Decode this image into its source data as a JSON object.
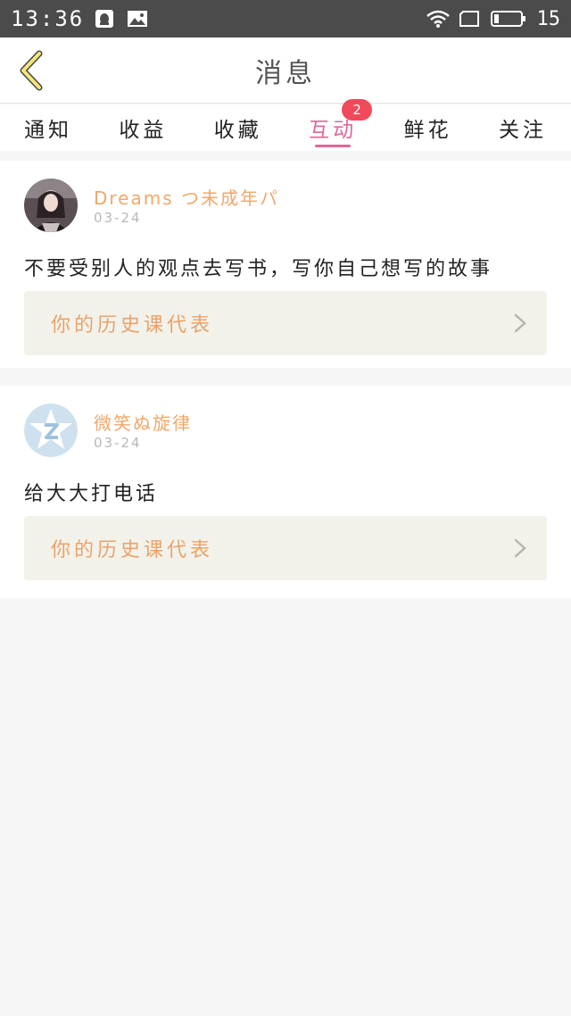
{
  "statusbar": {
    "time": "13:36",
    "battery": "15",
    "icons": [
      "qq-icon",
      "image-icon",
      "wifi-icon",
      "screen-icon",
      "battery-icon"
    ]
  },
  "header": {
    "back_icon": "chevron-left-icon",
    "title": "消息"
  },
  "tabs": [
    {
      "label": "通知",
      "active": false
    },
    {
      "label": "收益",
      "active": false
    },
    {
      "label": "收藏",
      "active": false
    },
    {
      "label": "互动",
      "active": true,
      "badge": "2"
    },
    {
      "label": "鲜花",
      "active": false
    },
    {
      "label": "关注",
      "active": false
    }
  ],
  "messages": [
    {
      "user": "Dreams つ未成年パ",
      "date": "03-24",
      "comment": "不要受别人的观点去写书，写你自己想写的故事",
      "reference": "你的历史课代表"
    },
    {
      "user": "微笑ぬ旋律",
      "date": "03-24",
      "comment": "给大大打电话",
      "reference": "你的历史课代表"
    }
  ],
  "colors": {
    "accent": "#e0669a",
    "username": "#f0a86a",
    "badge": "#f04a5a",
    "ref_bg": "#f3f2ea",
    "back_icon": "#f5e67a"
  }
}
